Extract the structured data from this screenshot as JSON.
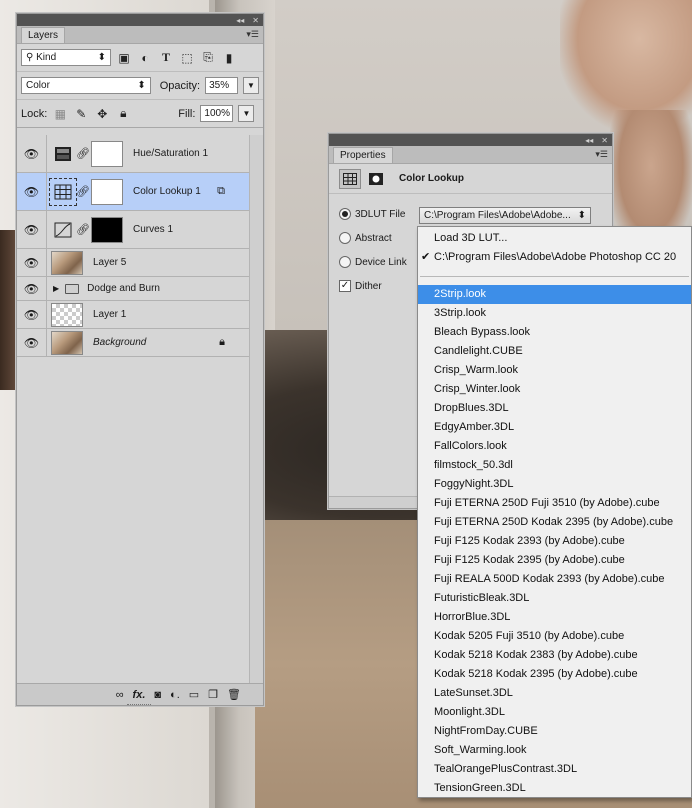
{
  "layers_panel": {
    "tab": "Layers",
    "kind_label": "Kind",
    "blend_mode": "Color",
    "opacity_label": "Opacity:",
    "opacity_value": "35%",
    "lock_label": "Lock:",
    "fill_label": "Fill:",
    "fill_value": "100%",
    "layers": [
      {
        "name": "Hue/Saturation 1",
        "type": "adjustment"
      },
      {
        "name": "Color Lookup 1",
        "type": "adjustment",
        "selected": true
      },
      {
        "name": "Curves 1",
        "type": "adjustment"
      },
      {
        "name": "Layer 5",
        "type": "pixel"
      },
      {
        "name": "Dodge and Burn",
        "type": "group"
      },
      {
        "name": "Layer 1",
        "type": "pixel"
      },
      {
        "name": "Background",
        "type": "background"
      }
    ]
  },
  "properties_panel": {
    "tab": "Properties",
    "title": "Color Lookup",
    "options": {
      "lut_file": "3DLUT File",
      "abstract": "Abstract",
      "device_link": "Device Link",
      "dither": "Dither"
    },
    "selected_lut": "C:\\Program Files\\Adobe\\Adobe..."
  },
  "dropdown": {
    "top_items": [
      "Load 3D LUT...",
      "C:\\Program Files\\Adobe\\Adobe Photoshop CC 20"
    ],
    "highlighted": "2Strip.look",
    "items": [
      "2Strip.look",
      "3Strip.look",
      "Bleach Bypass.look",
      "Candlelight.CUBE",
      "Crisp_Warm.look",
      "Crisp_Winter.look",
      "DropBlues.3DL",
      "EdgyAmber.3DL",
      "FallColors.look",
      "filmstock_50.3dl",
      "FoggyNight.3DL",
      "Fuji ETERNA 250D Fuji 3510 (by Adobe).cube",
      "Fuji ETERNA 250D Kodak 2395 (by Adobe).cube",
      "Fuji F125 Kodak 2393 (by Adobe).cube",
      "Fuji F125 Kodak 2395 (by Adobe).cube",
      "Fuji REALA 500D Kodak 2393 (by Adobe).cube",
      "FuturisticBleak.3DL",
      "HorrorBlue.3DL",
      "Kodak 5205 Fuji 3510 (by Adobe).cube",
      "Kodak 5218 Kodak 2383 (by Adobe).cube",
      "Kodak 5218 Kodak 2395 (by Adobe).cube",
      "LateSunset.3DL",
      "Moonlight.3DL",
      "NightFromDay.CUBE",
      "Soft_Warming.look",
      "TealOrangePlusContrast.3DL",
      "TensionGreen.3DL"
    ]
  }
}
